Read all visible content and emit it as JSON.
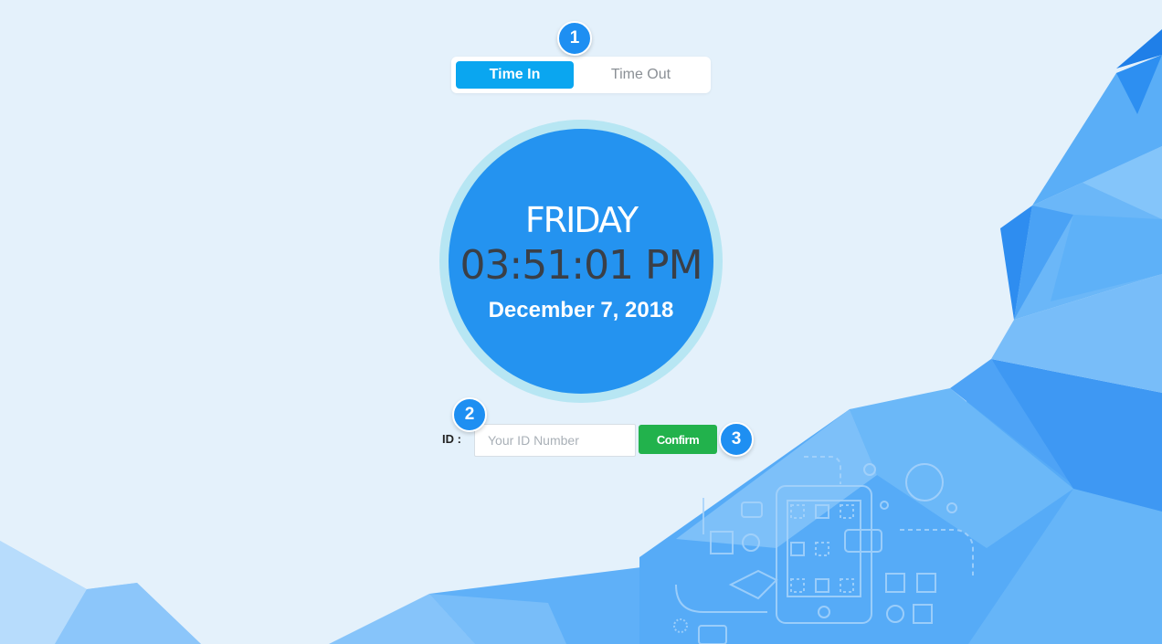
{
  "mode_toggle": {
    "options": [
      {
        "label": "Time In",
        "active": true
      },
      {
        "label": "Time Out",
        "active": false
      }
    ]
  },
  "clock": {
    "day": "FRIDAY",
    "time": "03:51:01 PM",
    "date": "December 7, 2018"
  },
  "id_form": {
    "label": "ID :",
    "placeholder": "Your ID Number",
    "value": "",
    "confirm_label": "Confirm"
  },
  "markers": [
    "1",
    "2",
    "3"
  ],
  "colors": {
    "background": "#e4f1fb",
    "accent": "#0aa6f0",
    "clock_fill": "#2493f0",
    "clock_ring": "#b7e6f3",
    "confirm": "#22b24c",
    "marker": "#1e8ff2"
  }
}
